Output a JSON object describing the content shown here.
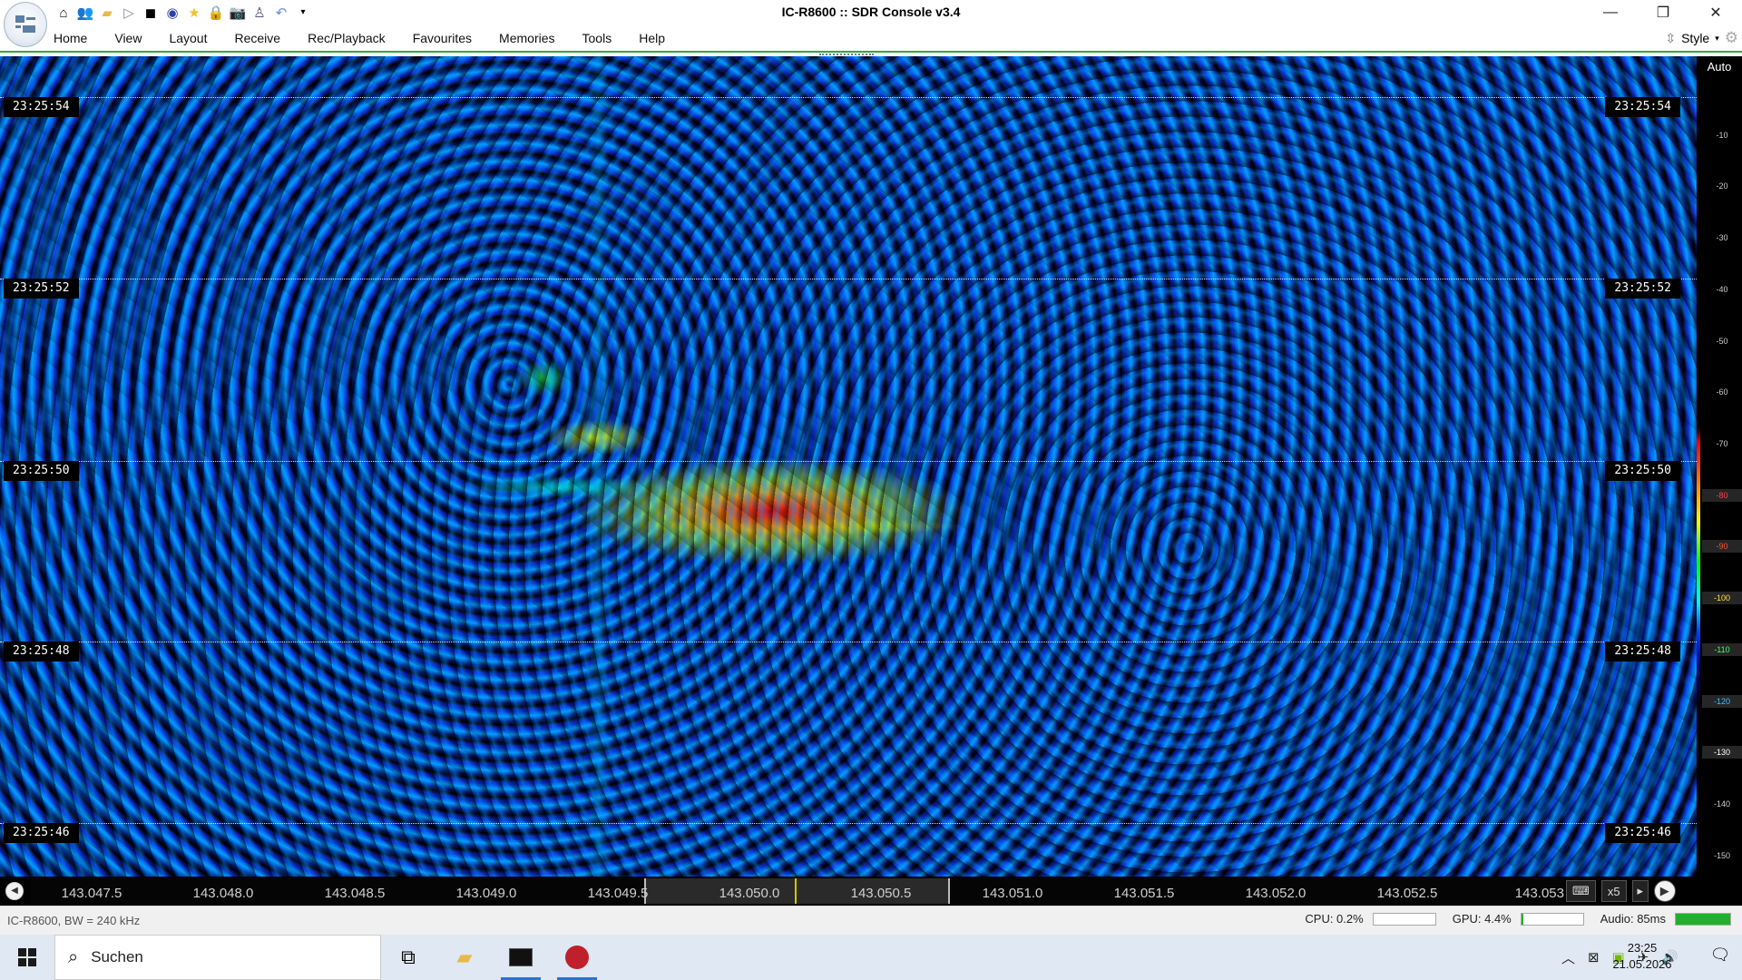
{
  "window": {
    "title": "IC-R8600 :: SDR Console v3.4"
  },
  "quick_access": [
    "home-icon",
    "users-icon",
    "folder-icon",
    "play-icon",
    "stop-icon",
    "record-icon",
    "favourite-star-icon",
    "lock-icon",
    "camera-icon",
    "satellite-icon",
    "undo-icon",
    "dropdown-icon"
  ],
  "menu": {
    "items": [
      "Home",
      "View",
      "Layout",
      "Receive",
      "Rec/Playback",
      "Favourites",
      "Memories",
      "Tools",
      "Help"
    ],
    "style_label": "Style"
  },
  "waterfall": {
    "time_marks": [
      "23:25:54",
      "23:25:52",
      "23:25:50",
      "23:25:48",
      "23:25:46"
    ]
  },
  "scale": {
    "mode": "Auto",
    "ticks": [
      "-10",
      "-20",
      "-30",
      "-40",
      "-50",
      "-60",
      "-70",
      "-80",
      "-90",
      "-100",
      "-110",
      "-120",
      "-130",
      "-140",
      "-150"
    ],
    "highlighted_ticks": [
      "-80",
      "-90",
      "-100",
      "-110",
      "-120",
      "-130"
    ]
  },
  "frequency": {
    "labels": [
      "143.047.5",
      "143.048.0",
      "143.048.5",
      "143.049.0",
      "143.049.5",
      "143.050.0",
      "143.050.5",
      "143.051.0",
      "143.051.5",
      "143.052.0",
      "143.052.5",
      "143.053"
    ],
    "zoom": "x5"
  },
  "status": {
    "device": "IC-R8600, BW = 240 kHz",
    "cpu": "CPU: 0.2%",
    "gpu": "GPU: 4.4%",
    "audio": "Audio: 85ms",
    "gpu_level": 0.04,
    "audio_level": 1.0
  },
  "taskbar": {
    "search_placeholder": "Suchen",
    "time": "23:25",
    "date": "21.05.2026"
  }
}
